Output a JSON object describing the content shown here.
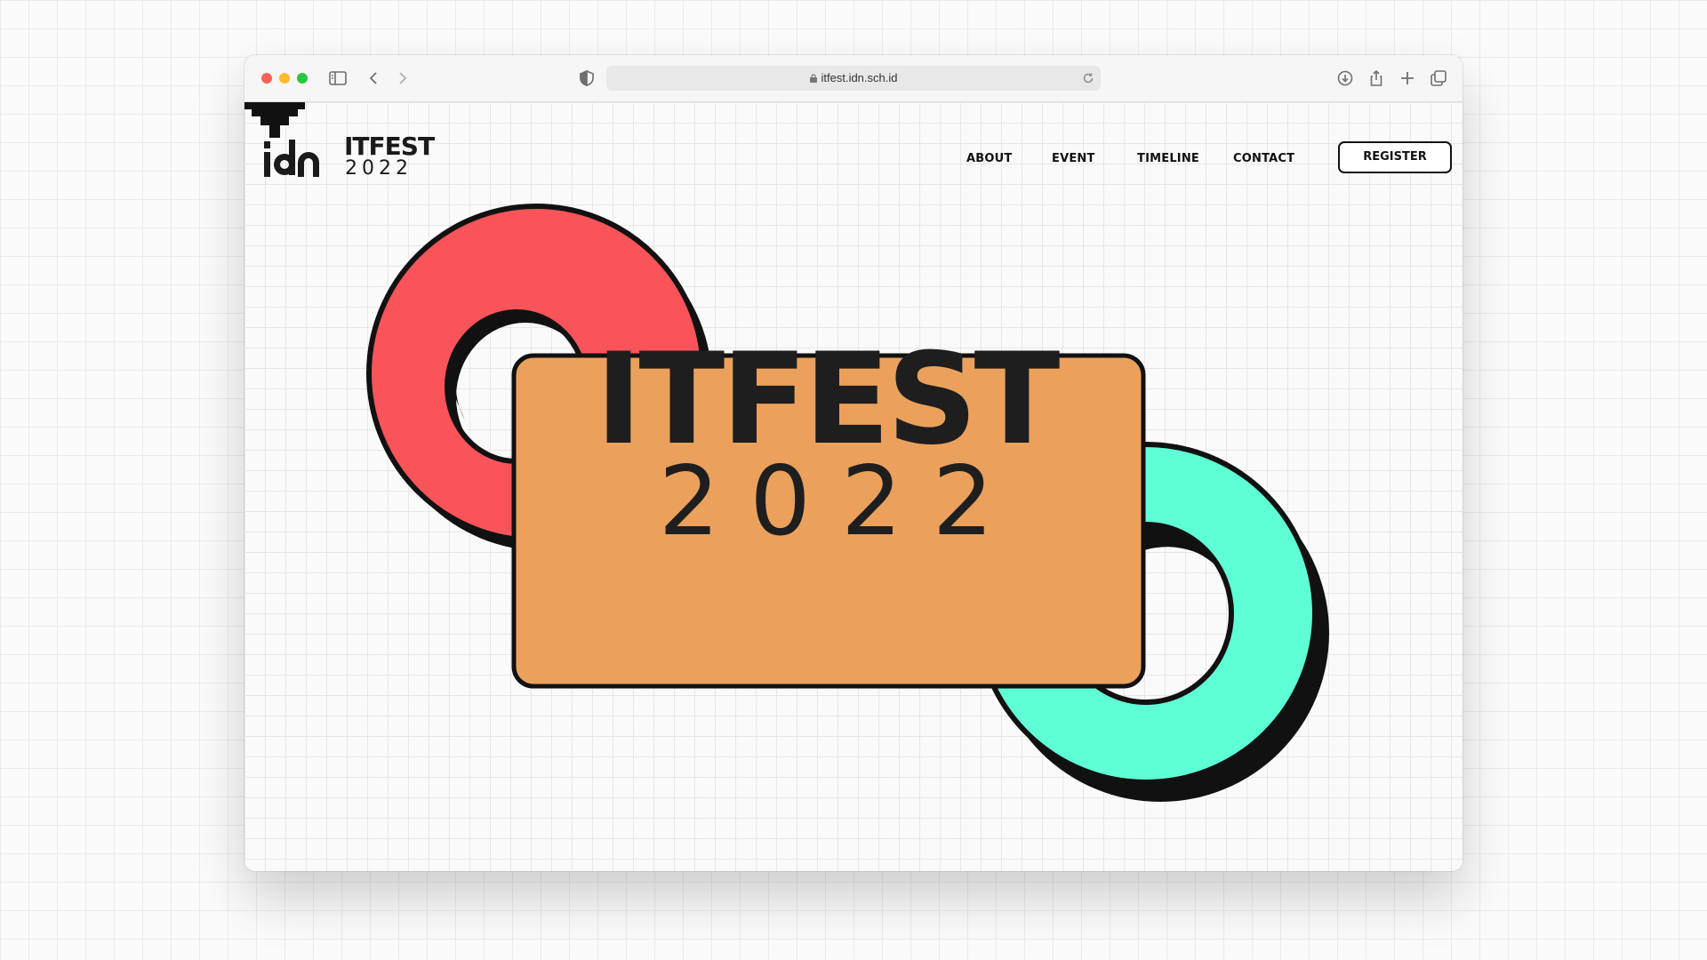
{
  "browser": {
    "url": "itfest.idn.sch.id"
  },
  "logo": {
    "brand_mark": "idn",
    "word": "ITFEST",
    "year": "2022"
  },
  "nav": {
    "items": [
      "ABOUT",
      "EVENT",
      "TIMELINE",
      "CONTACT"
    ],
    "register_label": "REGISTER"
  },
  "hero": {
    "title": "ITFEST",
    "year": "2022",
    "colors": {
      "card": "#eba15c",
      "red_ring": "#f9545a",
      "teal_ring": "#5fffd5",
      "outline": "#111111"
    }
  },
  "icons": {
    "scroll": "scroll-down-arrow-icon"
  }
}
